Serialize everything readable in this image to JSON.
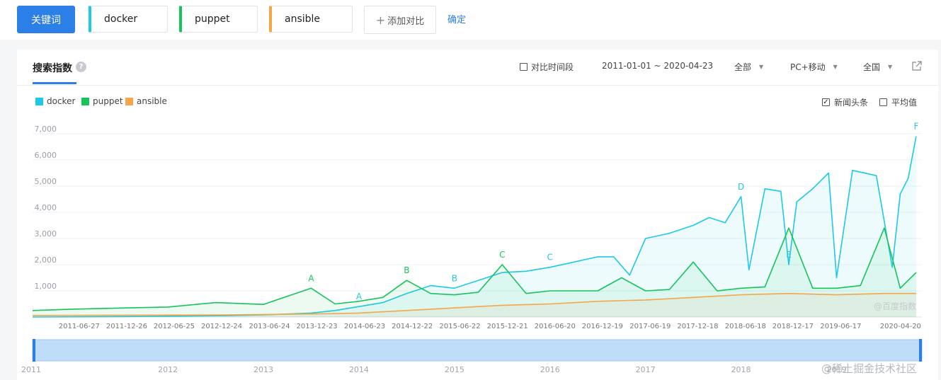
{
  "header": {
    "keyword_button": "关键词",
    "keywords": [
      {
        "value": "docker",
        "color": "#1ec8e8"
      },
      {
        "value": "puppet",
        "color": "#16c45a"
      },
      {
        "value": "ansible",
        "color": "#f5a64a"
      }
    ],
    "add_compare": "添加对比",
    "confirm": "确定"
  },
  "panel": {
    "tab_title": "搜索指数",
    "help": "?",
    "compare_period": "对比时间段",
    "date_range": "2011-01-01 ~ 2020-04-23",
    "filter_all": "全部",
    "filter_device": "PC+移动",
    "filter_region": "全国",
    "news_headline": "新闻头条",
    "news_headline_checked": true,
    "average": "平均值",
    "average_checked": false,
    "watermark": "@百度指数"
  },
  "site_watermark": "@稀土掘金技术社区",
  "chart_data": {
    "type": "area",
    "title": "",
    "y_ticks": [
      "1,000",
      "2,000",
      "3,000",
      "4,000",
      "5,000",
      "6,000",
      "7,000"
    ],
    "ylim": [
      0,
      7000
    ],
    "x_ticks": [
      "2011-06-27",
      "2011-12-26",
      "2012-06-25",
      "2012-12-24",
      "2013-06-24",
      "2013-12-23",
      "2014-06-23",
      "2014-12-22",
      "2015-06-22",
      "2015-12-21",
      "2016-06-20",
      "2016-12-19",
      "2017-06-19",
      "2017-12-18",
      "2018-06-18",
      "2018-12-17",
      "2019-06-17",
      "2020-04-20"
    ],
    "slider_years": [
      "2011",
      "2012",
      "2013",
      "2014",
      "2015",
      "2016",
      "2017",
      "2018",
      "2019"
    ],
    "legend_position": "top-left",
    "grid": true,
    "series": [
      {
        "name": "docker",
        "color": "#1ec8e8",
        "points": [
          [
            "2011-01",
            0
          ],
          [
            "2012-01",
            20
          ],
          [
            "2013-01",
            50
          ],
          [
            "2013-06",
            80
          ],
          [
            "2013-12",
            150
          ],
          [
            "2014-03",
            250
          ],
          [
            "2014-06",
            400
          ],
          [
            "2014-09",
            550
          ],
          [
            "2014-12",
            900
          ],
          [
            "2015-03",
            1200
          ],
          [
            "2015-06",
            1100
          ],
          [
            "2015-09",
            1400
          ],
          [
            "2015-12",
            1700
          ],
          [
            "2016-03",
            1750
          ],
          [
            "2016-06",
            1900
          ],
          [
            "2016-09",
            2100
          ],
          [
            "2016-12",
            2300
          ],
          [
            "2017-02",
            2300
          ],
          [
            "2017-04",
            1600
          ],
          [
            "2017-06",
            3000
          ],
          [
            "2017-09",
            3200
          ],
          [
            "2017-12",
            3500
          ],
          [
            "2018-02",
            3800
          ],
          [
            "2018-04",
            3600
          ],
          [
            "2018-06",
            4600
          ],
          [
            "2018-07",
            1800
          ],
          [
            "2018-09",
            4900
          ],
          [
            "2018-11",
            4800
          ],
          [
            "2018-12",
            2000
          ],
          [
            "2019-01",
            4400
          ],
          [
            "2019-03",
            4900
          ],
          [
            "2019-05",
            5500
          ],
          [
            "2019-06",
            1500
          ],
          [
            "2019-08",
            5600
          ],
          [
            "2019-11",
            5400
          ],
          [
            "2020-01",
            1900
          ],
          [
            "2020-02",
            4700
          ],
          [
            "2020-03",
            5300
          ],
          [
            "2020-04",
            6900
          ]
        ]
      },
      {
        "name": "puppet",
        "color": "#16c45a",
        "points": [
          [
            "2011-01",
            250
          ],
          [
            "2011-06",
            300
          ],
          [
            "2012-01",
            350
          ],
          [
            "2012-06",
            380
          ],
          [
            "2012-12",
            550
          ],
          [
            "2013-06",
            480
          ],
          [
            "2013-12",
            1100
          ],
          [
            "2014-03",
            500
          ],
          [
            "2014-06",
            600
          ],
          [
            "2014-09",
            750
          ],
          [
            "2014-12",
            1400
          ],
          [
            "2015-03",
            900
          ],
          [
            "2015-06",
            850
          ],
          [
            "2015-09",
            950
          ],
          [
            "2015-12",
            2000
          ],
          [
            "2016-03",
            900
          ],
          [
            "2016-06",
            1000
          ],
          [
            "2016-09",
            1000
          ],
          [
            "2016-12",
            1000
          ],
          [
            "2017-03",
            1500
          ],
          [
            "2017-06",
            1000
          ],
          [
            "2017-09",
            1050
          ],
          [
            "2017-12",
            2100
          ],
          [
            "2018-03",
            1000
          ],
          [
            "2018-06",
            1100
          ],
          [
            "2018-09",
            1150
          ],
          [
            "2018-12",
            3400
          ],
          [
            "2019-03",
            1100
          ],
          [
            "2019-06",
            1100
          ],
          [
            "2019-09",
            1200
          ],
          [
            "2019-12",
            3400
          ],
          [
            "2020-02",
            1100
          ],
          [
            "2020-04",
            1700
          ]
        ]
      },
      {
        "name": "ansible",
        "color": "#f5a64a",
        "points": [
          [
            "2011-01",
            60
          ],
          [
            "2012-01",
            70
          ],
          [
            "2013-01",
            80
          ],
          [
            "2014-01",
            120
          ],
          [
            "2014-06",
            150
          ],
          [
            "2014-12",
            250
          ],
          [
            "2015-06",
            350
          ],
          [
            "2015-12",
            450
          ],
          [
            "2016-06",
            500
          ],
          [
            "2016-12",
            600
          ],
          [
            "2017-06",
            650
          ],
          [
            "2017-12",
            750
          ],
          [
            "2018-06",
            850
          ],
          [
            "2018-12",
            900
          ],
          [
            "2019-06",
            850
          ],
          [
            "2019-12",
            900
          ],
          [
            "2020-04",
            900
          ]
        ]
      }
    ],
    "annotations": [
      {
        "label": "A",
        "series": "puppet",
        "x": "2013-12"
      },
      {
        "label": "A",
        "series": "docker",
        "x": "2014-06"
      },
      {
        "label": "B",
        "series": "puppet",
        "x": "2014-12"
      },
      {
        "label": "B",
        "series": "docker",
        "x": "2015-06"
      },
      {
        "label": "C",
        "series": "puppet",
        "x": "2015-12"
      },
      {
        "label": "C",
        "series": "docker",
        "x": "2016-06"
      },
      {
        "label": "D",
        "series": "docker",
        "x": "2018-06"
      },
      {
        "label": "E",
        "series": "docker",
        "x": "2018-12"
      },
      {
        "label": "F",
        "series": "docker",
        "x": "2020-04"
      }
    ]
  }
}
